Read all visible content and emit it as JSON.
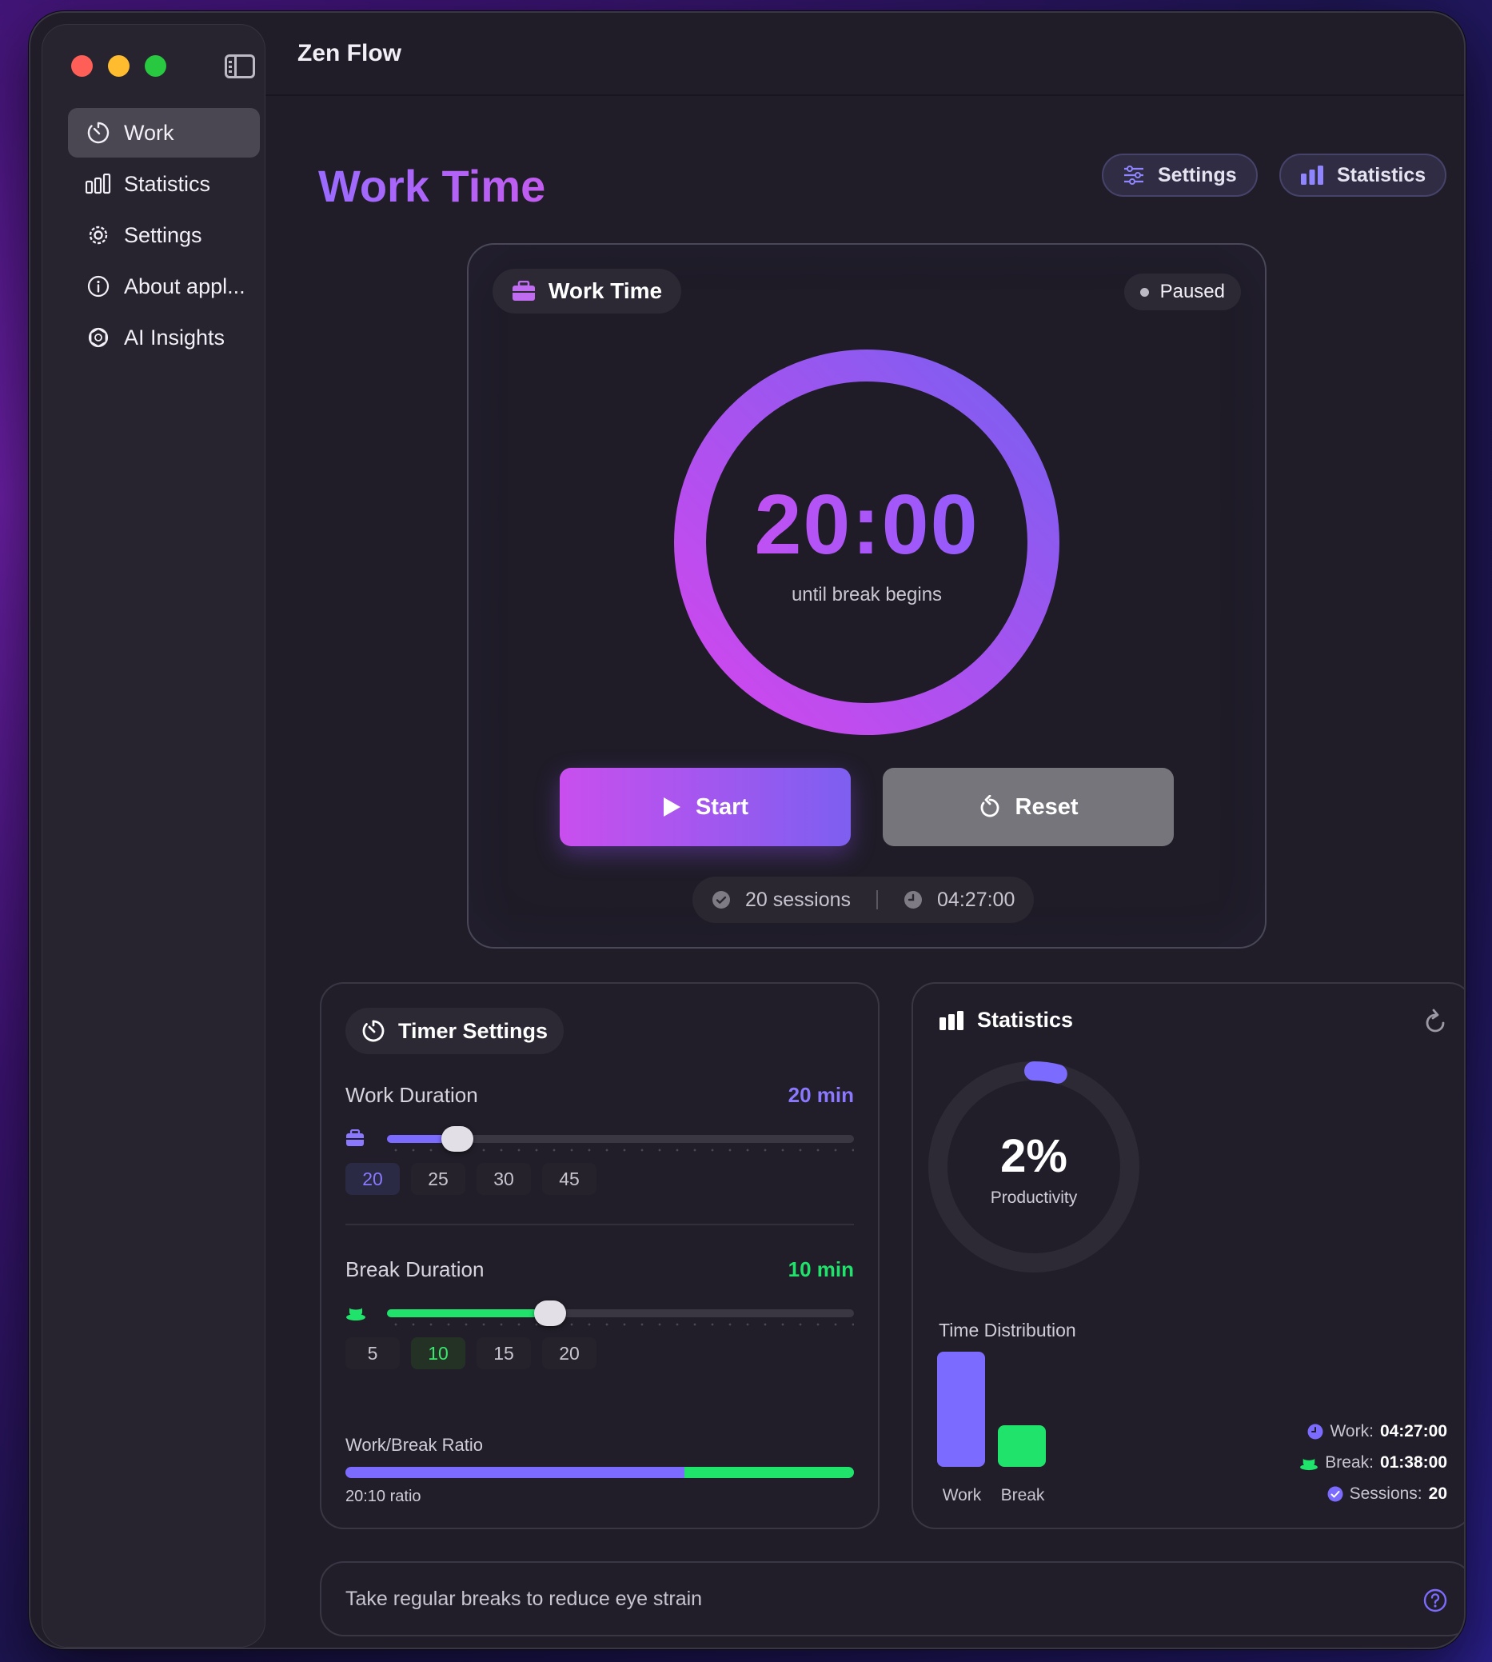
{
  "app": {
    "title": "Zen Flow"
  },
  "sidebar": {
    "items": [
      {
        "label": "Work",
        "icon": "timer-icon",
        "active": true
      },
      {
        "label": "Statistics",
        "icon": "bar-chart-icon",
        "active": false
      },
      {
        "label": "Settings",
        "icon": "gear-icon",
        "active": false
      },
      {
        "label": "About appl...",
        "icon": "info-icon",
        "active": false
      },
      {
        "label": "AI Insights",
        "icon": "openai-icon",
        "active": false
      }
    ]
  },
  "header": {
    "page_title": "Work Time",
    "settings_label": "Settings",
    "statistics_label": "Statistics"
  },
  "timer": {
    "mode_label": "Work Time",
    "status": "Paused",
    "time": "20:00",
    "subtitle": "until break begins",
    "start_label": "Start",
    "reset_label": "Reset",
    "sessions": "20 sessions",
    "total_time": "04:27:00"
  },
  "timer_settings": {
    "title": "Timer Settings",
    "work": {
      "label": "Work Duration",
      "value": "20 min",
      "slider_fraction": 0.15,
      "presets": [
        "20",
        "25",
        "30",
        "45"
      ],
      "selected": "20"
    },
    "break": {
      "label": "Break Duration",
      "value": "10 min",
      "slider_fraction": 0.35,
      "presets": [
        "5",
        "10",
        "15",
        "20"
      ],
      "selected": "10"
    },
    "ratio": {
      "label": "Work/Break Ratio",
      "work_fraction": 0.667,
      "text": "20:10 ratio"
    }
  },
  "statistics": {
    "title": "Statistics",
    "productivity_value": "2%",
    "productivity_fraction": 0.02,
    "productivity_label": "Productivity",
    "distribution_title": "Time Distribution",
    "bars": [
      {
        "label": "Work",
        "fraction": 1.0
      },
      {
        "label": "Break",
        "fraction": 0.36
      }
    ],
    "legend": [
      {
        "label": "Work:",
        "value": "04:27:00"
      },
      {
        "label": "Break:",
        "value": "01:38:00"
      },
      {
        "label": "Sessions:",
        "value": "20"
      }
    ]
  },
  "tip": {
    "text": "Take regular breaks to reduce eye strain"
  },
  "colors": {
    "accent_purple": "#7b6bff",
    "accent_green": "#1fe36a",
    "magenta": "#d04cf0"
  }
}
